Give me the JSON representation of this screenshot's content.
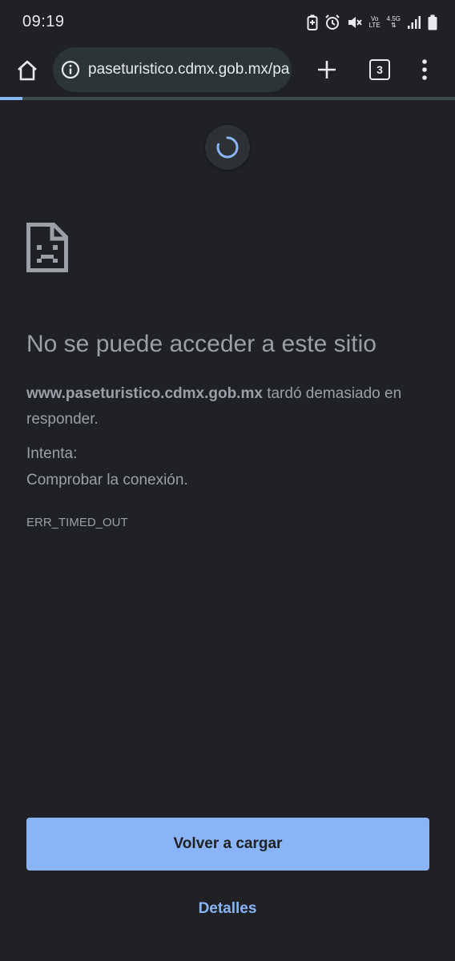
{
  "status_bar": {
    "time": "09:19",
    "network_top": "Vo",
    "network_bottom": "LTE",
    "network_type": "4.5G",
    "icons": [
      "battery-saver-icon",
      "alarm-icon",
      "mute-icon",
      "volte-icon",
      "network-type-icon",
      "signal-icon",
      "battery-icon"
    ]
  },
  "toolbar": {
    "url": "paseturistico.cdmx.gob.mx/pa",
    "tab_count": "3",
    "page_load_progress": 0.05
  },
  "error": {
    "title": "No se puede acceder a este sitio",
    "host": "www.paseturistico.cdmx.gob.mx",
    "message": " tardó demasiado en responder.",
    "suggestion_label": "Intenta:",
    "suggestion": "Comprobar la conexión.",
    "code": "ERR_TIMED_OUT"
  },
  "actions": {
    "reload_label": "Volver a cargar",
    "details_label": "Detalles"
  },
  "colors": {
    "background": "#202124",
    "accent": "#8ab4f8",
    "text": "#9aa0a6",
    "omnibox": "#2b3436"
  }
}
